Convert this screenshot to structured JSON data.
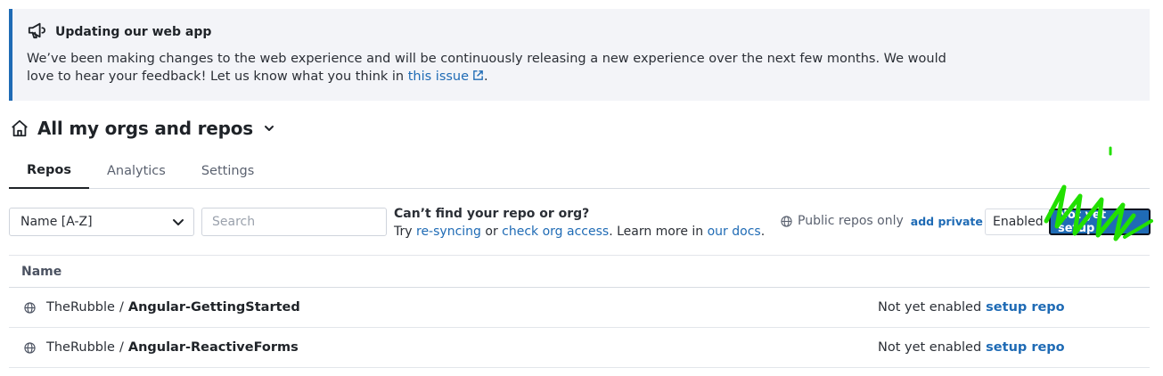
{
  "banner": {
    "title": "Updating our web app",
    "text_before_link": "We’ve been making changes to the web experience and will be continuously releasing a new experience over the next few months. We would love to hear your feedback! Let us know what you think in ",
    "link_label": "this issue",
    "text_after_link": "."
  },
  "org": {
    "title": "All my orgs and repos"
  },
  "tabs": [
    {
      "label": "Repos"
    },
    {
      "label": "Analytics"
    },
    {
      "label": "Settings"
    }
  ],
  "filters": {
    "sort_value": "Name [A-Z]",
    "search_placeholder": "Search",
    "cant_find_title": "Can’t find your repo or org?",
    "try_text": "Try ",
    "resync_link": "re-syncing",
    "or_text": " or ",
    "check_access_link": "check org access",
    "learn_text": ". Learn more in ",
    "docs_link": "our docs",
    "end_text": ".",
    "public_only_label": "Public repos only",
    "add_private_link": "add private",
    "seg_enabled": "Enabled",
    "seg_not_setup": "Not yet setup"
  },
  "table": {
    "header_name": "Name",
    "rows": [
      {
        "owner": "TheRubble",
        "separator": "/",
        "repo": "Angular-GettingStarted",
        "status": "Not yet enabled",
        "action": "setup repo"
      },
      {
        "owner": "TheRubble",
        "separator": "/",
        "repo": "Angular-ReactiveForms",
        "status": "Not yet enabled",
        "action": "setup repo"
      }
    ]
  },
  "colors": {
    "accent": "#1f6bb5",
    "banner_bg": "#f3f4f8",
    "scribble": "#22e000"
  },
  "icons": [
    "megaphone-icon",
    "external-link-icon",
    "home-icon",
    "chevron-down-icon",
    "globe-icon"
  ]
}
